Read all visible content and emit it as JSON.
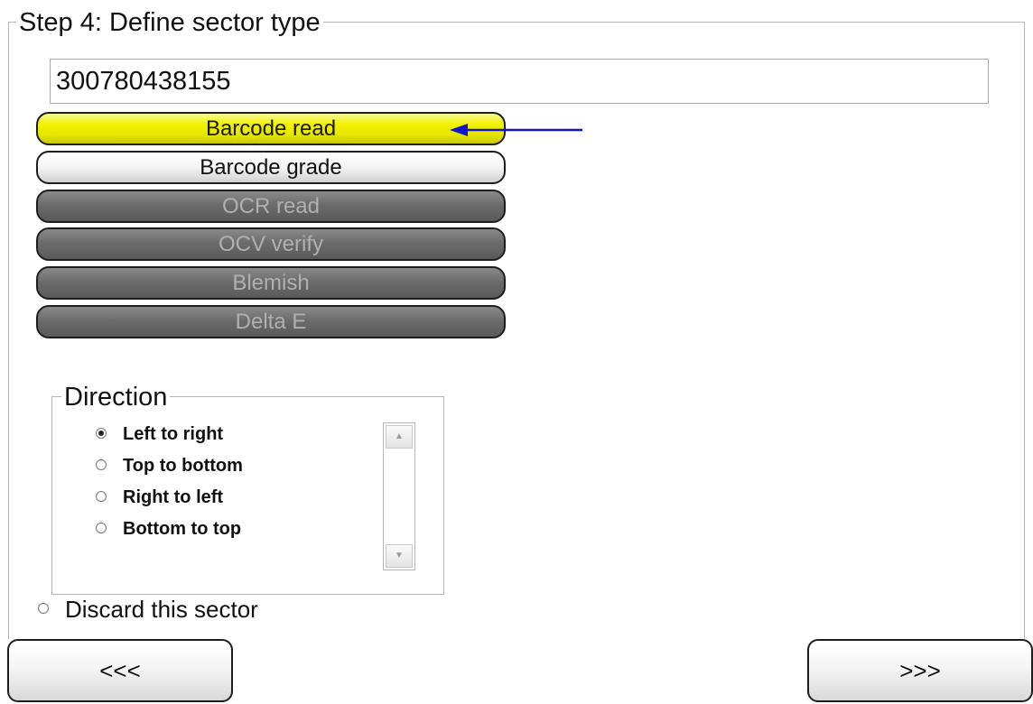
{
  "step": {
    "title": "Step 4: Define sector type"
  },
  "code_field": {
    "value": "300780438155"
  },
  "sector_types": [
    {
      "label": "Barcode read",
      "state": "selected"
    },
    {
      "label": "Barcode grade",
      "state": "enabled"
    },
    {
      "label": "OCR read",
      "state": "disabled"
    },
    {
      "label": "OCV verify",
      "state": "disabled"
    },
    {
      "label": "Blemish",
      "state": "disabled"
    },
    {
      "label": "Delta E",
      "state": "disabled"
    }
  ],
  "pointer": {
    "color": "#1414c8"
  },
  "direction": {
    "title": "Direction",
    "options": [
      {
        "label": "Left to right",
        "checked": true
      },
      {
        "label": "Top to bottom",
        "checked": false
      },
      {
        "label": "Right to left",
        "checked": false
      },
      {
        "label": "Bottom to top",
        "checked": false
      }
    ],
    "scroll_up_icon": "triangle-up",
    "scroll_down_icon": "triangle-down"
  },
  "discard": {
    "label": "Discard this sector",
    "checked": false
  },
  "nav": {
    "back_label": "<<<",
    "next_label": ">>>"
  },
  "colors": {
    "selected_button": "#f2f200",
    "disabled_button": "#6c6c6c",
    "disabled_text": "#b0b0b0"
  }
}
